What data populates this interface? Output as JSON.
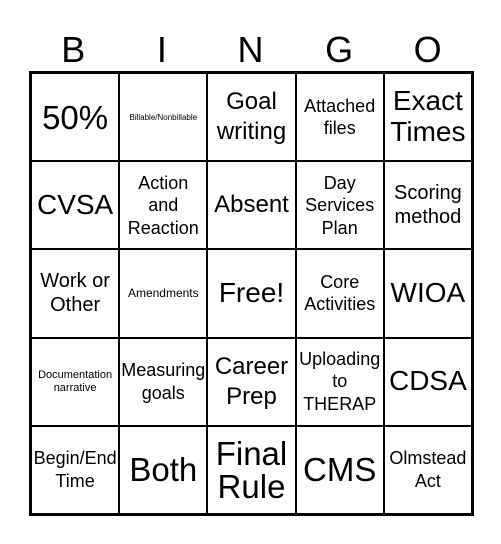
{
  "header": {
    "letters": [
      "B",
      "I",
      "N",
      "G",
      "O"
    ]
  },
  "cells": [
    "50%",
    "Billable/Nonbillable",
    "Goal writing",
    "Attached files",
    "Exact Times",
    "CVSA",
    "Action and Reaction",
    "Absent",
    "Day Services Plan",
    "Scoring method",
    "Work or Other",
    "Amendments",
    "Free!",
    "Core Activities",
    "WIOA",
    "Documentation narrative",
    "Measuring goals",
    "Career Prep",
    "Uploading to THERAP",
    "CDSA",
    "Begin/End Time",
    "Both",
    "Final Rule",
    "CMS",
    "Olmstead Act"
  ]
}
